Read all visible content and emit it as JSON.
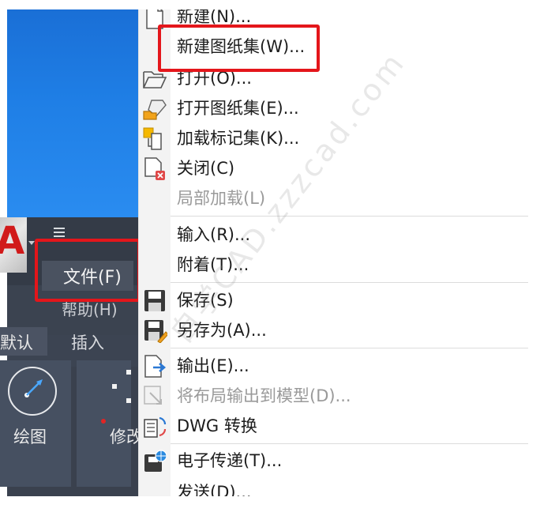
{
  "app": {
    "file_menu": "文件(F)",
    "help_menu": "帮助(H)",
    "ribbon_tabs": [
      "默认",
      "插入"
    ],
    "panels": {
      "draw": "绘图",
      "modify": "修改"
    }
  },
  "menu_items": [
    {
      "label": "新建(N)...",
      "icon": "new-file-icon",
      "disabled": false
    },
    {
      "label": "新建图纸集(W)...",
      "icon": "",
      "disabled": false
    },
    {
      "label": "打开(O)...",
      "icon": "open-folder-icon",
      "disabled": false
    },
    {
      "label": "打开图纸集(E)...",
      "icon": "open-sheet-set-icon",
      "disabled": false
    },
    {
      "label": "加载标记集(K)...",
      "icon": "markup-set-icon",
      "disabled": false
    },
    {
      "label": "关闭(C)",
      "icon": "close-file-icon",
      "disabled": false
    },
    {
      "label": "局部加载(L)",
      "icon": "",
      "disabled": true
    },
    {
      "label": "输入(R)...",
      "icon": "",
      "disabled": false
    },
    {
      "label": "附着(T)...",
      "icon": "",
      "disabled": false
    },
    {
      "label": "保存(S)",
      "icon": "save-icon",
      "disabled": false
    },
    {
      "label": "另存为(A)...",
      "icon": "save-as-icon",
      "disabled": false
    },
    {
      "label": "输出(E)...",
      "icon": "export-icon",
      "disabled": false
    },
    {
      "label": "将布局输出到模型(D)...",
      "icon": "layout-to-model-icon",
      "disabled": true
    },
    {
      "label": "DWG 转换",
      "icon": "dwg-convert-icon",
      "disabled": false
    },
    {
      "label": "电子传递(T)...",
      "icon": "etransmit-icon",
      "disabled": false
    },
    {
      "label": "发送(D)...",
      "icon": "",
      "disabled": false
    }
  ],
  "watermark": "自学CAD.zzzcad.com",
  "colors": {
    "highlight": "#e4161b",
    "app_bg": "#3b4350",
    "desktop": "#1f7fe6"
  }
}
